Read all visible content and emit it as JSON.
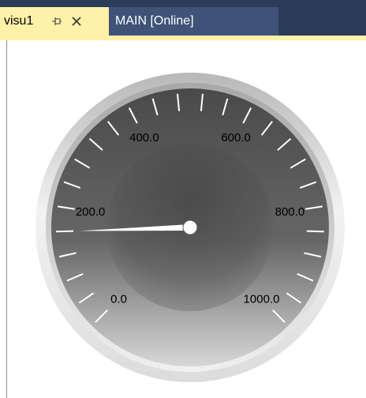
{
  "tabs": [
    {
      "label": "visu1",
      "active": true,
      "pin_icon": "pin-icon",
      "close_icon": "close-icon"
    },
    {
      "label": "MAIN [Online]",
      "active": false
    }
  ],
  "gauge": {
    "min": 0,
    "max": 1000,
    "value": 160,
    "scale_labels": [
      "0.0",
      "200.0",
      "400.0",
      "600.0",
      "800.0",
      "1000.0"
    ],
    "needle_color": "#ffffff",
    "accent_color": "#8fd8e6"
  }
}
